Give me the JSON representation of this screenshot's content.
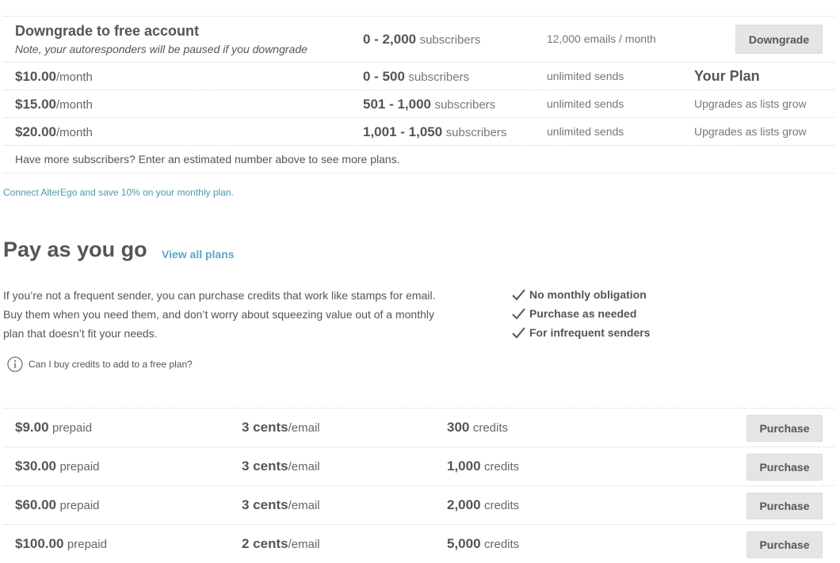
{
  "monthly_plans": {
    "free_row": {
      "title": "Downgrade to free account",
      "note": "Note, your autoresponders will be paused if you downgrade",
      "range": "0 - 2,000",
      "range_unit": "subscribers",
      "sends": "12,000 emails / month",
      "button_label": "Downgrade"
    },
    "rows": [
      {
        "price": "$10.00",
        "price_unit": "/month",
        "range": "0 - 500",
        "range_unit": "subscribers",
        "sends": "unlimited sends",
        "status": "Your Plan"
      },
      {
        "price": "$15.00",
        "price_unit": "/month",
        "range": "501 - 1,000",
        "range_unit": "subscribers",
        "sends": "unlimited sends",
        "status": "Upgrades as lists grow"
      },
      {
        "price": "$20.00",
        "price_unit": "/month",
        "range": "1,001 - 1,050",
        "range_unit": "subscribers",
        "sends": "unlimited sends",
        "status": "Upgrades as lists grow"
      }
    ],
    "more_text": "Have more subscribers? Enter an estimated number above to see more plans."
  },
  "connect_link": "Connect AlterEgo and save 10% on your monthly plan.",
  "payg": {
    "title": "Pay as you go",
    "view_all": "View all plans",
    "description": "If you’re not a frequent sender, you can purchase credits that work like stamps for email. Buy them when you need them, and don’t worry about squeezing value out of a monthly plan that doesn’t fit your needs.",
    "benefits": [
      "No monthly obligation",
      "Purchase as needed",
      "For infrequent senders"
    ],
    "faq": "Can I buy credits to add to a free plan?",
    "rows": [
      {
        "price": "$9.00",
        "price_unit": "prepaid",
        "rate": "3 cents",
        "rate_unit": "/email",
        "credits": "300",
        "credits_unit": "credits",
        "button_label": "Purchase"
      },
      {
        "price": "$30.00",
        "price_unit": "prepaid",
        "rate": "3 cents",
        "rate_unit": "/email",
        "credits": "1,000",
        "credits_unit": "credits",
        "button_label": "Purchase"
      },
      {
        "price": "$60.00",
        "price_unit": "prepaid",
        "rate": "3 cents",
        "rate_unit": "/email",
        "credits": "2,000",
        "credits_unit": "credits",
        "button_label": "Purchase"
      },
      {
        "price": "$100.00",
        "price_unit": "prepaid",
        "rate": "2 cents",
        "rate_unit": "/email",
        "credits": "5,000",
        "credits_unit": "credits",
        "button_label": "Purchase"
      }
    ]
  },
  "icons": {
    "check": "check-icon",
    "info": "info-icon"
  },
  "colors": {
    "link_teal": "#4a9aaa",
    "link_blue": "#5aa9c5",
    "button_bg": "#e5e5e5",
    "text": "#555555"
  }
}
